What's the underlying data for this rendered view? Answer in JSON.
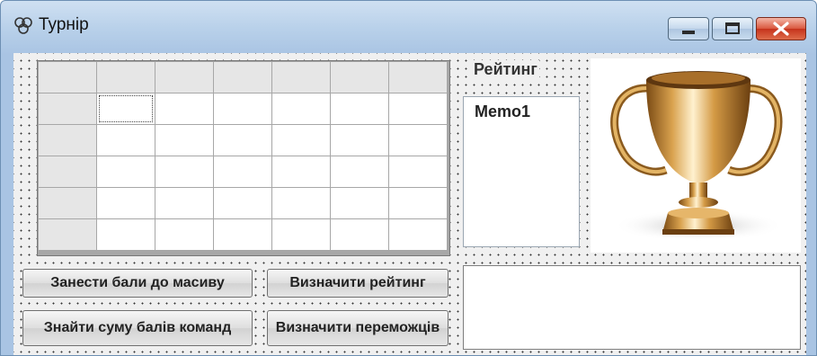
{
  "window": {
    "title": "Турнір",
    "controls": [
      "minimize",
      "maximize",
      "close"
    ]
  },
  "rating_label": "Рейтинг",
  "memo1": {
    "text": "Memo1"
  },
  "memo2": {
    "text": ""
  },
  "buttons": {
    "enter_scores": "Занести бали до масиву",
    "find_sum": "Знайти суму балів команд",
    "determine_rating": "Визначити рейтинг",
    "determine_winners": "Визначити переможців"
  },
  "grid": {
    "columns": 7,
    "rows": 6,
    "fixed_columns": 1,
    "fixed_rows": 1
  },
  "icons": {
    "app": "app-icon",
    "trophy": "trophy-image"
  },
  "colors": {
    "close": "#c6331c",
    "form_bg": "#f0f0f0"
  }
}
